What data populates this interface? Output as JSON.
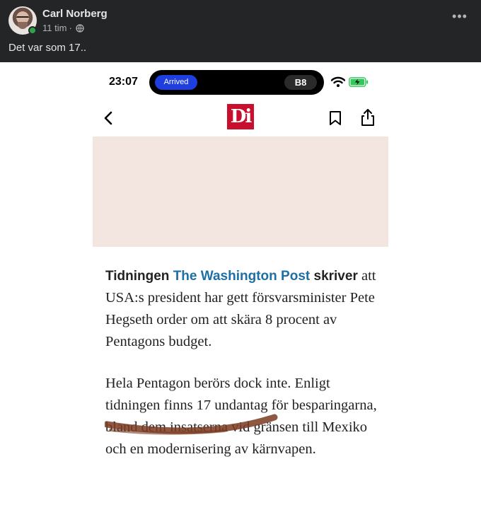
{
  "post": {
    "author": "Carl Norberg",
    "time": "11 tim",
    "separator": "·",
    "audience_icon": "globe-icon",
    "text": "Det var som 17..",
    "menu_icon": "more-options-icon"
  },
  "screenshot": {
    "status_bar": {
      "time": "23:07",
      "activity_label": "Arrived",
      "activity_badge": "B8",
      "icons": [
        "wifi-icon",
        "battery-charging-icon"
      ]
    },
    "app_bar": {
      "logo_text": "Di",
      "icons": [
        "back-icon",
        "bookmark-icon",
        "share-icon"
      ]
    },
    "article": {
      "lead_prefix": "Tidningen ",
      "lead_link": "The Washington Post",
      "lead_suffix": " skriver",
      "para1_rest": "att USA:s president har gett försvarsminister Pete Hegseth order om att skära 8 procent av Pentagons budget.",
      "para2": "Hela Pentagon berörs dock inte. Enligt tidningen finns 17 undantag för besparingarna, bland dem insatserna vid gränsen till Mexiko och en modernisering av kärnvapen."
    },
    "colors": {
      "di_red": "#c8102e",
      "link_blue": "#1d6fa5",
      "hero_bg": "#f3e6e1",
      "redaction_brown": "#7a3b22"
    }
  }
}
